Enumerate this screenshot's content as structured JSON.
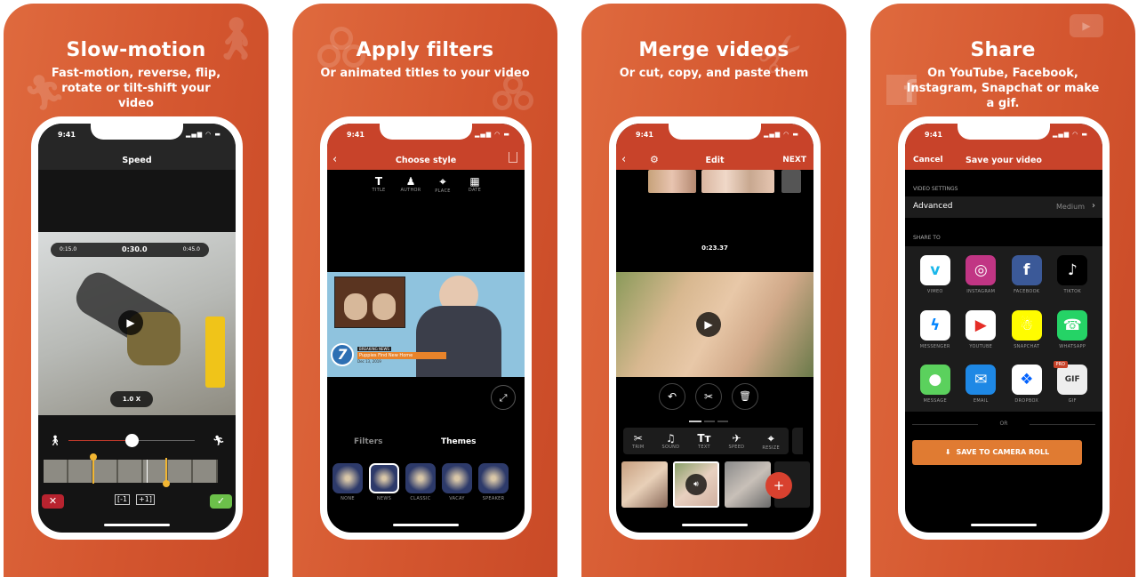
{
  "colors": {
    "brand": "#d4562f",
    "nav_bar": "#c8432a",
    "save_button": "#e07b32",
    "green": "#6cc04a",
    "red": "#b8232f",
    "yellow": "#f2b632"
  },
  "panels": [
    {
      "headline": "Slow-motion",
      "subtitle": "Fast-motion, reverse, flip, rotate or tilt-shift your video"
    },
    {
      "headline": "Apply filters",
      "subtitle": "Or animated titles to your video"
    },
    {
      "headline": "Merge videos",
      "subtitle": "Or cut, copy, and paste them"
    },
    {
      "headline": "Share",
      "subtitle": "On YouTube, Facebook, Instagram, Snapchat or make a gif."
    }
  ],
  "status_bar": {
    "time": "9:41",
    "icons": "signal wifi battery"
  },
  "speed_screen": {
    "title": "Speed",
    "timeline": [
      "0:15.0",
      "0:30.0",
      "0:45.0"
    ],
    "speed_value": "1.0 X",
    "slider_fraction": 0.5,
    "slow_icon": "walking-icon",
    "fast_icon": "running-icon",
    "trim_in_label": "[-1",
    "trim_out_label": "+1]"
  },
  "filters_screen": {
    "title": "Choose style",
    "tools": [
      {
        "icon": "T",
        "label": "TITLE"
      },
      {
        "icon": "♟",
        "label": "AUTHOR"
      },
      {
        "icon": "⌖",
        "label": "PLACE"
      },
      {
        "icon": "▦",
        "label": "DATE"
      }
    ],
    "news_banner": {
      "tag": "BREAKING NEWS",
      "headline": "Puppies Find New Home",
      "date": "Dec 13, 2019",
      "channel": "7"
    },
    "tabs": [
      {
        "label": "Filters",
        "active": false
      },
      {
        "label": "Themes",
        "active": true
      }
    ],
    "themes": [
      {
        "label": "NONE"
      },
      {
        "label": "NEWS",
        "selected": true
      },
      {
        "label": "CLASSIC"
      },
      {
        "label": "VACAY"
      },
      {
        "label": "SPEAKER"
      }
    ]
  },
  "edit_screen": {
    "title": "Edit",
    "next_label": "NEXT",
    "timestamp": "0:23.37",
    "actions": [
      "undo-icon",
      "scissors-icon",
      "trash-icon"
    ],
    "tools": [
      {
        "icon": "✂",
        "label": "TRIM"
      },
      {
        "icon": "♫",
        "label": "SOUND"
      },
      {
        "icon": "Tт",
        "label": "TEXT"
      },
      {
        "icon": "✈",
        "label": "SPEED"
      },
      {
        "icon": "⌖",
        "label": "RESIZE"
      }
    ],
    "add_label": "+"
  },
  "share_screen": {
    "cancel_label": "Cancel",
    "title": "Save your video",
    "settings_header": "VIDEO SETTINGS",
    "advanced_label": "Advanced",
    "advanced_value": "Medium",
    "share_header": "SHARE TO",
    "apps": [
      {
        "label": "VIMEO",
        "glyph": "v",
        "bg": "#ffffff",
        "fg": "#1ab7ea"
      },
      {
        "label": "INSTAGRAM",
        "glyph": "◎",
        "bg": "#c13584",
        "fg": "#ffffff"
      },
      {
        "label": "FACEBOOK",
        "glyph": "f",
        "bg": "#3b5998",
        "fg": "#ffffff"
      },
      {
        "label": "TIKTOK",
        "glyph": "♪",
        "bg": "#000000",
        "fg": "#ffffff"
      },
      {
        "label": "MESSENGER",
        "glyph": "ϟ",
        "bg": "#ffffff",
        "fg": "#0084ff"
      },
      {
        "label": "YOUTUBE",
        "glyph": "▶",
        "bg": "#ffffff",
        "fg": "#e52d27"
      },
      {
        "label": "SNAPCHAT",
        "glyph": "☃",
        "bg": "#fffc00",
        "fg": "#ffffff"
      },
      {
        "label": "WHATSAPP",
        "glyph": "☎",
        "bg": "#25d366",
        "fg": "#ffffff"
      },
      {
        "label": "MESSAGE",
        "glyph": "●",
        "bg": "#5bd15d",
        "fg": "#ffffff"
      },
      {
        "label": "EMAIL",
        "glyph": "✉",
        "bg": "#1e88e5",
        "fg": "#ffffff"
      },
      {
        "label": "DROPBOX",
        "glyph": "❖",
        "bg": "#ffffff",
        "fg": "#0061fe"
      },
      {
        "label": "GIF",
        "glyph": "GIF",
        "bg": "#eeeeee",
        "fg": "#333333",
        "badge": "PRO"
      }
    ],
    "or_label": "OR",
    "save_label": "SAVE TO CAMERA ROLL"
  }
}
